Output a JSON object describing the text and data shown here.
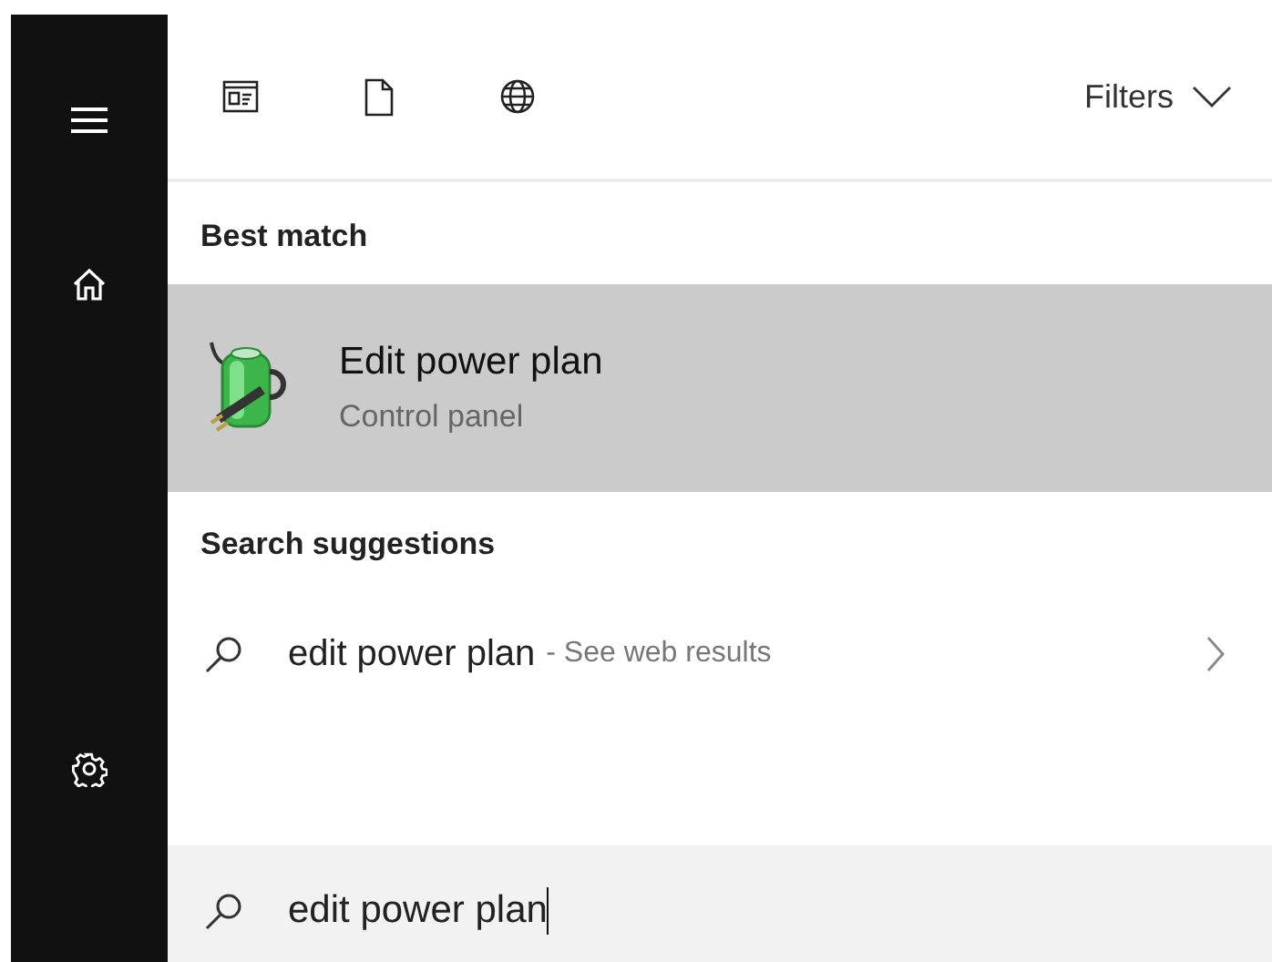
{
  "toolbar": {
    "filters": "Filters"
  },
  "best_match": {
    "heading": "Best match",
    "items": [
      {
        "title": "Edit power plan",
        "subtitle": "Control panel",
        "selected": true
      }
    ]
  },
  "suggestions": {
    "heading": "Search suggestions",
    "items": [
      {
        "query": "edit power plan",
        "hint": "- See web results",
        "selected": false
      }
    ]
  },
  "search_box": {
    "value": "edit power plan"
  }
}
